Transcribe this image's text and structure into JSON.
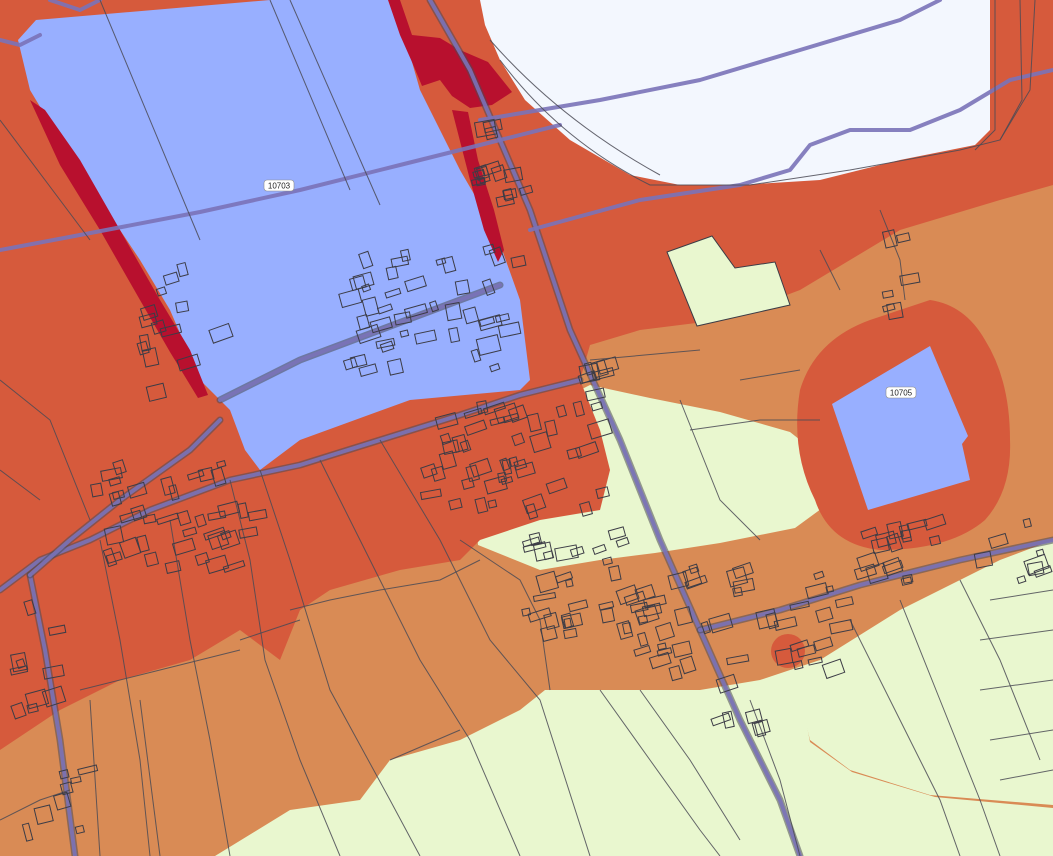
{
  "map": {
    "zone_labels": [
      "10703",
      "10705"
    ],
    "colors": {
      "background_light": "#e9f7cf",
      "orange": "#d98b55",
      "red_orange": "#d65a3c",
      "dark_red": "#b8102e",
      "blue": "#98afff",
      "white_area": "#f3f7fe",
      "road": "#7a72b8",
      "outline": "#3c3c46"
    }
  }
}
